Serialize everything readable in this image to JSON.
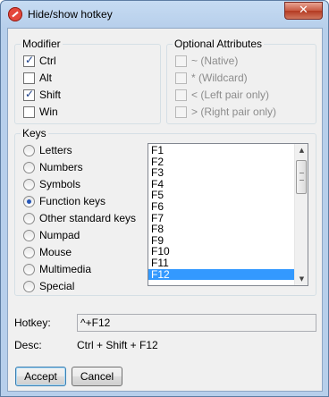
{
  "window": {
    "title": "Hide/show hotkey",
    "close_glyph": "✕"
  },
  "modifier": {
    "title": "Modifier",
    "items": [
      {
        "label": "Ctrl",
        "checked": true
      },
      {
        "label": "Alt",
        "checked": false
      },
      {
        "label": "Shift",
        "checked": true
      },
      {
        "label": "Win",
        "checked": false
      }
    ]
  },
  "optional": {
    "title": "Optional Attributes",
    "items": [
      {
        "label": "~ (Native)",
        "checked": false,
        "enabled": false
      },
      {
        "label": "* (Wildcard)",
        "checked": false,
        "enabled": false
      },
      {
        "label": "< (Left pair only)",
        "checked": false,
        "enabled": false
      },
      {
        "label": "> (Right pair only)",
        "checked": false,
        "enabled": false
      }
    ]
  },
  "keys": {
    "title": "Keys",
    "radios": [
      {
        "label": "Letters",
        "checked": false
      },
      {
        "label": "Numbers",
        "checked": false
      },
      {
        "label": "Symbols",
        "checked": false
      },
      {
        "label": "Function keys",
        "checked": true
      },
      {
        "label": "Other standard keys",
        "checked": false
      },
      {
        "label": "Numpad",
        "checked": false
      },
      {
        "label": "Mouse",
        "checked": false
      },
      {
        "label": "Multimedia",
        "checked": false
      },
      {
        "label": "Special",
        "checked": false
      }
    ],
    "list": [
      "F1",
      "F2",
      "F3",
      "F4",
      "F5",
      "F6",
      "F7",
      "F8",
      "F9",
      "F10",
      "F11",
      "F12"
    ],
    "selected": "F12"
  },
  "hotkey": {
    "label": "Hotkey:",
    "value": "^+F12"
  },
  "desc": {
    "label": "Desc:",
    "value": "Ctrl + Shift + F12"
  },
  "buttons": {
    "accept": "Accept",
    "cancel": "Cancel"
  }
}
